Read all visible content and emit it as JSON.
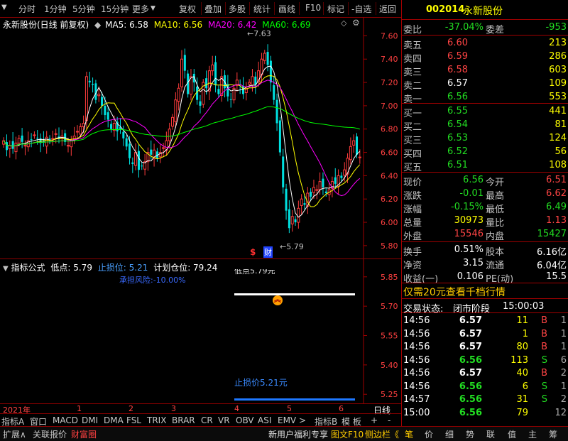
{
  "toolbar": {
    "period_tabs": [
      "分时",
      "1分钟",
      "5分钟",
      "15分钟",
      "更多"
    ],
    "actions": [
      "复权",
      "叠加",
      "多股",
      "统计",
      "画线",
      "F10",
      "标记",
      "-自选",
      "返回"
    ]
  },
  "chart": {
    "title": "永新股份(日线 前复权)",
    "ma": [
      {
        "label": "MA5: 6.58",
        "color": "#ffffff"
      },
      {
        "label": "MA10: 6.56",
        "color": "#ffff00"
      },
      {
        "label": "MA20: 6.42",
        "color": "#ff00ff"
      },
      {
        "label": "MA60: 6.69",
        "color": "#00ff00"
      }
    ],
    "y_ticks": [
      "7.60",
      "7.40",
      "7.20",
      "7.00",
      "6.80",
      "6.60",
      "6.40",
      "6.20",
      "6.00",
      "5.80"
    ],
    "high_label": "7.63",
    "low_label": "5.79",
    "marker_dollar": "$",
    "marker_cai": "财"
  },
  "indicator": {
    "title": "指标公式",
    "low_point": "低点: 5.79",
    "stop_loss": "止损位: 5.21",
    "position": "计划仓位: 79.24",
    "buy_label": "低点5.79元",
    "risk_label": "承担风险:-10.00%",
    "stop_price_label": "止损价5.21元",
    "y_ticks": [
      "5.85",
      "5.70",
      "5.55",
      "5.40",
      "5.25"
    ]
  },
  "time_axis": {
    "labels": [
      "2021年",
      "1",
      "2",
      "3",
      "4",
      "5",
      "6"
    ],
    "right_label": "日线"
  },
  "indicator_tabs": [
    "指标A",
    "窗口",
    "MACD",
    "DMI",
    "DMA",
    "FSL",
    "TRIX",
    "BRAR",
    "CR",
    "VR",
    "OBV",
    "ASI",
    "EMV",
    ">",
    "指标B",
    "模 板",
    "+",
    "-"
  ],
  "bottom_bar": {
    "left": [
      "扩展∧",
      "关联报价",
      "财富圈"
    ],
    "promo": "新用户福利专享",
    "f10": "图文F10",
    "sidebar": "侧边栏《",
    "right_tabs": [
      "笔",
      "价",
      "细",
      "势",
      "联",
      "值",
      "主",
      "筹"
    ]
  },
  "quote": {
    "code": "002014",
    "name": "永新股份",
    "weibi_label": "委比",
    "weibi": "-37.04%",
    "weicha_label": "委差",
    "weicha": "-953",
    "asks": [
      {
        "label": "卖五",
        "price": "6.60",
        "vol": "213"
      },
      {
        "label": "卖四",
        "price": "6.59",
        "vol": "286"
      },
      {
        "label": "卖三",
        "price": "6.58",
        "vol": "603"
      },
      {
        "label": "卖二",
        "price": "6.57",
        "vol": "109"
      },
      {
        "label": "卖一",
        "price": "6.56",
        "vol": "553"
      }
    ],
    "bids": [
      {
        "label": "买一",
        "price": "6.55",
        "vol": "441"
      },
      {
        "label": "买二",
        "price": "6.54",
        "vol": "81"
      },
      {
        "label": "买三",
        "price": "6.53",
        "vol": "124"
      },
      {
        "label": "买四",
        "price": "6.52",
        "vol": "56"
      },
      {
        "label": "买五",
        "price": "6.51",
        "vol": "108"
      }
    ],
    "stats": [
      {
        "l1": "现价",
        "v1": "6.56",
        "l2": "今开",
        "v2": "6.51"
      },
      {
        "l1": "涨跌",
        "v1": "-0.01",
        "l2": "最高",
        "v2": "6.62"
      },
      {
        "l1": "涨幅",
        "v1": "-0.15%",
        "l2": "最低",
        "v2": "6.49"
      },
      {
        "l1": "总量",
        "v1": "30973",
        "l2": "量比",
        "v2": "1.13"
      },
      {
        "l1": "外盘",
        "v1": "15546",
        "l2": "内盘",
        "v2": "15427"
      }
    ],
    "stats2": [
      {
        "l1": "换手",
        "v1": "0.51%",
        "l2": "股本",
        "v2": "6.16亿"
      },
      {
        "l1": "净资",
        "v1": "3.15",
        "l2": "流通",
        "v2": "6.04亿"
      },
      {
        "l1": "收益(一)",
        "v1": "0.106",
        "l2": "PE(动)",
        "v2": "15.5"
      }
    ],
    "promo": "仅需20元查看千档行情",
    "status_label": "交易状态:",
    "status_value": "闭市阶段",
    "status_time": "15:00:03",
    "ticks": [
      {
        "t": "14:56",
        "p": "6.57",
        "v": "11",
        "s": "B",
        "n": "1"
      },
      {
        "t": "14:56",
        "p": "6.57",
        "v": "1",
        "s": "B",
        "n": "1"
      },
      {
        "t": "14:56",
        "p": "6.57",
        "v": "80",
        "s": "B",
        "n": "1"
      },
      {
        "t": "14:56",
        "p": "6.56",
        "v": "113",
        "s": "S",
        "n": "6"
      },
      {
        "t": "14:56",
        "p": "6.57",
        "v": "40",
        "s": "B",
        "n": "2"
      },
      {
        "t": "14:56",
        "p": "6.56",
        "v": "6",
        "s": "S",
        "n": "1"
      },
      {
        "t": "14:57",
        "p": "6.56",
        "v": "31",
        "s": "S",
        "n": "2"
      },
      {
        "t": "15:00",
        "p": "6.56",
        "v": "79",
        "s": "",
        "n": "12"
      }
    ]
  }
}
